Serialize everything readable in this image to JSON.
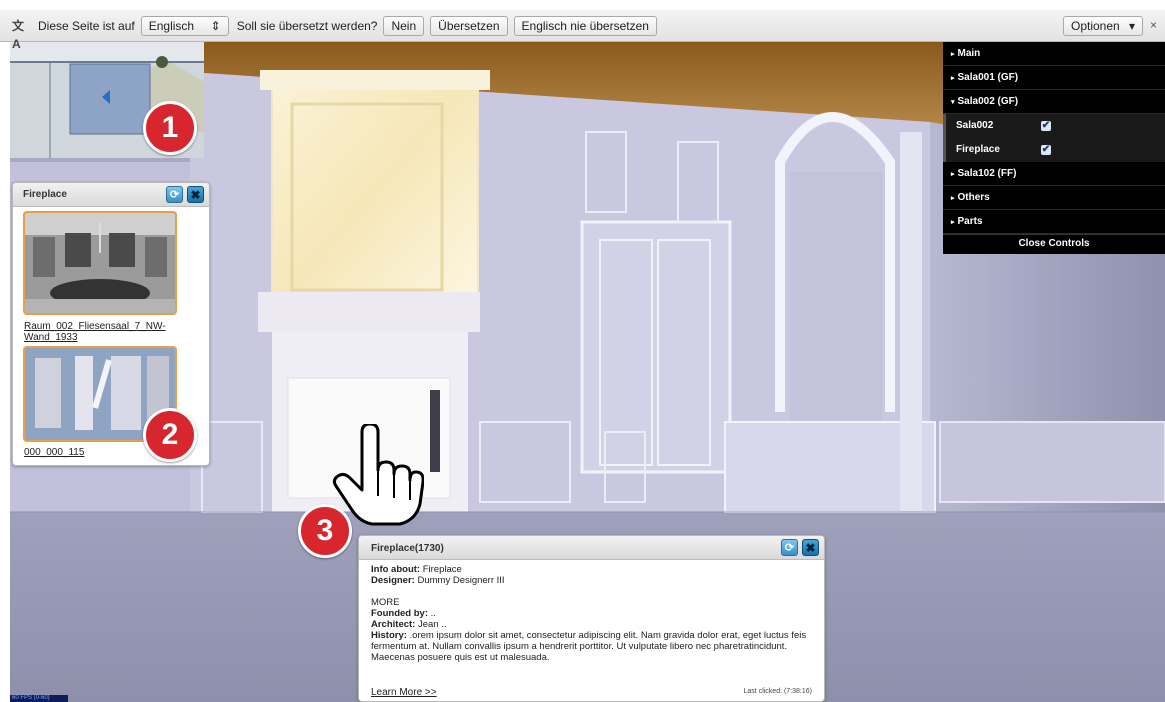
{
  "translate_bar": {
    "icon": "translate-icon",
    "prefix": "Diese Seite ist auf",
    "language": "Englisch",
    "question": "Soll sie übersetzt werden?",
    "no_label": "Nein",
    "translate_label": "Übersetzen",
    "never_label": "Englisch nie übersetzen",
    "options_label": "Optionen",
    "close": "×"
  },
  "markers": [
    "1",
    "2",
    "3"
  ],
  "gallery": {
    "title": "Fireplace",
    "items": [
      {
        "label_line1": "Raum_002_Fliesensaal_7_NW-",
        "label_line2": "Wand_1933"
      },
      {
        "label_line1": "000_000_115",
        "label_line2": ""
      }
    ]
  },
  "controls": {
    "rows": [
      "Main",
      "Sala001 (GF)",
      "Sala002 (GF)"
    ],
    "subitems": [
      {
        "label": "Sala002",
        "checked": true
      },
      {
        "label": "Fireplace",
        "checked": true
      }
    ],
    "rows_after": [
      "Sala102 (FF)",
      "Others",
      "Parts"
    ],
    "close_label": "Close Controls"
  },
  "info": {
    "title": "Fireplace(1730)",
    "info_about_label": "Info about:",
    "info_about_value": "Fireplace",
    "designer_label": "Designer:",
    "designer_value": "Dummy Designerr III",
    "more": "MORE",
    "founded_label": "Founded by:",
    "founded_value": "..",
    "architect_label": "Architect:",
    "architect_value": "Jean ..",
    "history_label": "History:",
    "history_value": ".orem ipsum dolor sit amet, consectetur adipiscing elit. Nam gravida dolor erat, eget luctus feis fermentum at. Nullam convallis ipsum a hendrerit porttitor. Ut vulputate libero nec pharetratincidunt. Maecenas posuere quis est ut malesuada.",
    "learn_more": "Learn More >>",
    "last_clicked": "Last clicked: (7:38:16)"
  },
  "fps_text": "60 FPS (0-60)"
}
